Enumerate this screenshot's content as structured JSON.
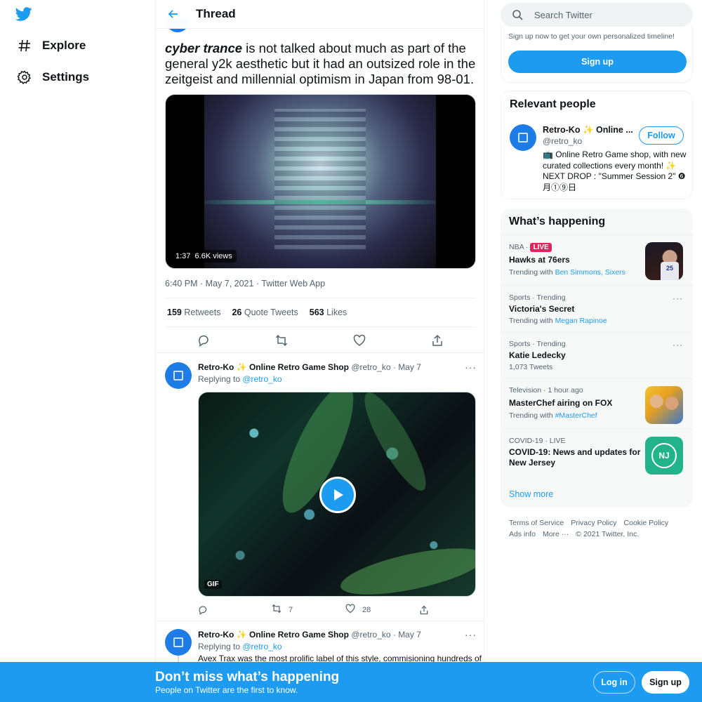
{
  "nav": {
    "items": [
      {
        "label": "Explore",
        "icon": "hash-icon"
      },
      {
        "label": "Settings",
        "icon": "gear-icon"
      }
    ]
  },
  "header": {
    "title": "Thread"
  },
  "tweet": {
    "text_emph": "cyber trance",
    "text_rest": " is not talked about much as part of the general y2k aesthetic but it had an outsized role in the zeitgeist and millennial optimism in Japan from 98-01.",
    "video": {
      "duration": "1:37",
      "views": "6.6K views"
    },
    "meta": "6:40 PM · May 7, 2021 · Twitter Web App",
    "stats": [
      {
        "count": "159",
        "label": "Retweets"
      },
      {
        "count": "26",
        "label": "Quote Tweets"
      },
      {
        "count": "563",
        "label": "Likes"
      }
    ]
  },
  "replies": [
    {
      "name": "Retro-Ko ✨ Online Retro Game Shop",
      "handle": "@retro_ko",
      "date": "· May 7",
      "replying_prefix": "Replying to ",
      "replying_to": "@retro_ko",
      "media_label": "GIF",
      "retweets": "7",
      "likes": "28"
    },
    {
      "name": "Retro-Ko ✨ Online Retro Game Shop",
      "handle": "@retro_ko",
      "date": "· May 7",
      "replying_prefix": "Replying to ",
      "replying_to": "@retro_ko",
      "text": "Avex Trax was the most prolific label of this style, commisioning hundreds of"
    }
  ],
  "search": {
    "placeholder": "Search Twitter"
  },
  "signup_box": {
    "text": "Sign up now to get your own personalized timeline!",
    "button": "Sign up"
  },
  "relevant": {
    "title": "Relevant people",
    "name": "Retro-Ko ✨ Online ...",
    "handle": "@retro_ko",
    "follow": "Follow",
    "bio": "📺 Online Retro Game shop, with new curated collections every month! ✨ NEXT DROP : \"Summer Session 2\" ❻月①⑨日"
  },
  "happening": {
    "title": "What’s happening",
    "trends": [
      {
        "category": "NBA ·",
        "live": "LIVE",
        "name": "Hawks at 76ers",
        "sub_prefix": "Trending with ",
        "sub_links": "Ben Simmons, Sixers"
      },
      {
        "category": "Sports · Trending",
        "name": "Victoria's Secret",
        "sub_prefix": "Trending with ",
        "sub_links": "Megan Rapinoe"
      },
      {
        "category": "Sports · Trending",
        "name": "Katie Ledecky",
        "sub_prefix": "1,073 Tweets",
        "sub_links": ""
      },
      {
        "category": "Television · 1 hour ago",
        "name": "MasterChef airing on FOX",
        "sub_prefix": "Trending with ",
        "sub_links": "#MasterChef"
      },
      {
        "category": "COVID-19 · LIVE",
        "name": "COVID-19: News and updates for New Jersey",
        "sub_prefix": "",
        "sub_links": ""
      }
    ],
    "nj_badge": "NJ",
    "jersey_number": "25",
    "show_more": "Show more"
  },
  "footer": {
    "links": [
      "Terms of Service",
      "Privacy Policy",
      "Cookie Policy",
      "Ads info",
      "More ···",
      "© 2021 Twitter, Inc."
    ]
  },
  "banner": {
    "headline": "Don’t miss what’s happening",
    "sub": "People on Twitter are the first to know.",
    "login": "Log in",
    "signup": "Sign up"
  },
  "colors": {
    "accent": "#1d9bf0",
    "live": "#e0245e",
    "text": "#0f1419",
    "secondary": "#536471"
  }
}
